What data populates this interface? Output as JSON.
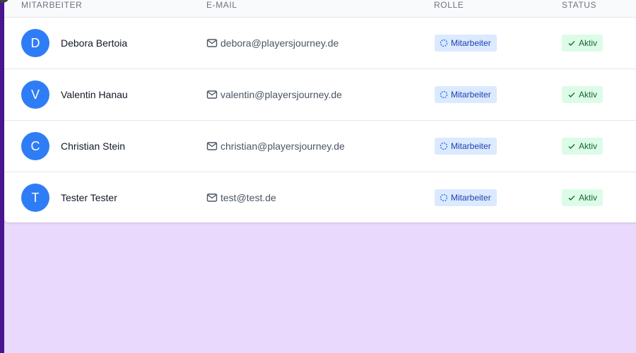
{
  "table": {
    "headers": {
      "employee": "MITARBEITER",
      "email": "E-MAIL",
      "role": "ROLLE",
      "status": "STATUS"
    },
    "rows": [
      {
        "initial": "D",
        "name": "Debora Bertoia",
        "email": "debora@playersjourney.de",
        "role": "Mitarbeiter",
        "status": "Aktiv"
      },
      {
        "initial": "V",
        "name": "Valentin Hanau",
        "email": "valentin@playersjourney.de",
        "role": "Mitarbeiter",
        "status": "Aktiv"
      },
      {
        "initial": "C",
        "name": "Christian Stein",
        "email": "christian@playersjourney.de",
        "role": "Mitarbeiter",
        "status": "Aktiv"
      },
      {
        "initial": "T",
        "name": "Tester Tester",
        "email": "test@test.de",
        "role": "Mitarbeiter",
        "status": "Aktiv"
      }
    ]
  },
  "icons": {
    "email": "mail-icon",
    "role": "spinner-icon",
    "status": "check-icon"
  },
  "colors": {
    "avatar": "#2f7df6",
    "role_badge_bg": "#dbeafe",
    "role_badge_text": "#1e40af",
    "status_badge_bg": "#dcfce7",
    "status_badge_text": "#166534",
    "background": "#e9d9fd",
    "sidebar": "#4a1690"
  }
}
